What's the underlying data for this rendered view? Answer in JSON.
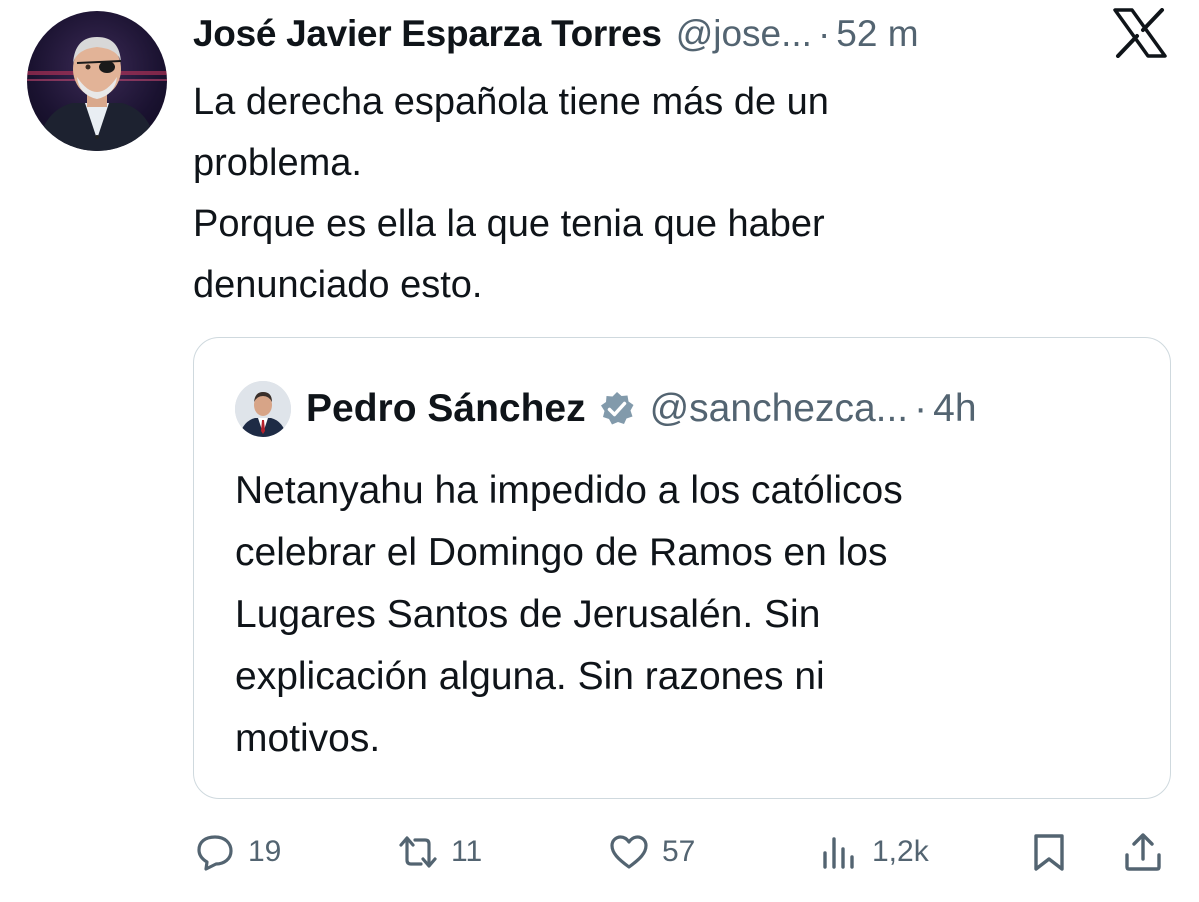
{
  "tweet": {
    "author_name": "José Javier Esparza Torres",
    "author_handle": "@jose...",
    "separator": "·",
    "time": "52 m",
    "text_lines": [
      "La derecha española tiene más de un",
      "problema.",
      "Porque es ella la que tenia que haber",
      "denunciado esto."
    ]
  },
  "quote": {
    "author_name": "Pedro Sánchez",
    "author_handle": "@sanchezca...",
    "separator": "·",
    "time": "4h",
    "verified": true,
    "text_lines": [
      "Netanyahu ha impedido a los católicos",
      "celebrar el Domingo de Ramos en los",
      "Lugares Santos de Jerusalén. Sin",
      "explicación alguna. Sin razones ni",
      "motivos."
    ]
  },
  "actions": {
    "replies": "19",
    "reposts": "11",
    "likes": "57",
    "views": "1,2k"
  },
  "icons": {
    "logo": "x-logo-icon",
    "verified": "verified-badge-icon",
    "reply": "reply-icon",
    "repost": "repost-icon",
    "like": "heart-icon",
    "views": "views-icon",
    "bookmark": "bookmark-icon",
    "share": "share-icon"
  },
  "colors": {
    "text": "#0f1419",
    "secondary": "#536471",
    "border": "#cfd9de"
  }
}
